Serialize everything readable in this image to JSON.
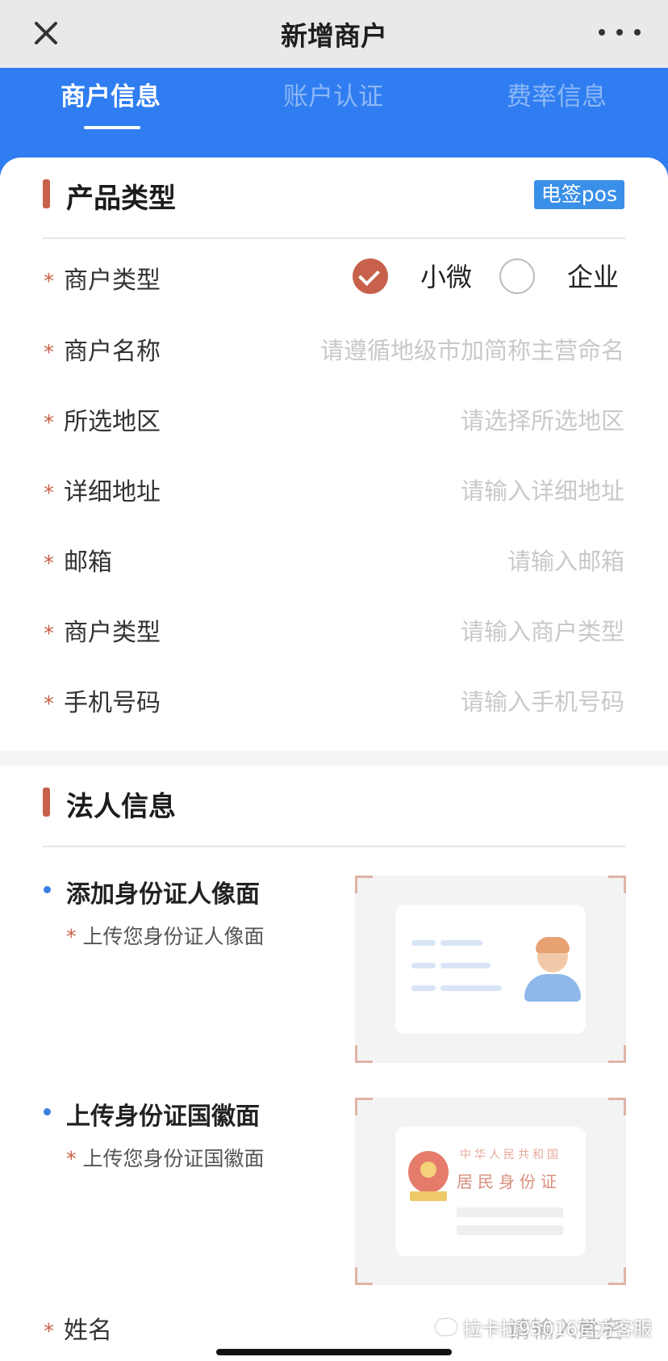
{
  "header": {
    "title": "新增商户"
  },
  "tabs": [
    {
      "label": "商户信息"
    },
    {
      "label": "账户认证"
    },
    {
      "label": "费率信息"
    }
  ],
  "product": {
    "section_title": "产品类型",
    "badge": "电签pos",
    "required_mark": "*",
    "merchant_type": {
      "label": "商户类型",
      "options": [
        {
          "label": "小微",
          "selected": true
        },
        {
          "label": "企业",
          "selected": false
        }
      ]
    },
    "fields": [
      {
        "label": "商户名称",
        "placeholder": "请遵循地级市加简称主营命名"
      },
      {
        "label": "所选地区",
        "placeholder": "请选择所选地区"
      },
      {
        "label": "详细地址",
        "placeholder": "请输入详细地址"
      },
      {
        "label": "邮箱",
        "placeholder": "请输入邮箱"
      },
      {
        "label": "商户类型",
        "placeholder": "请输入商户类型"
      },
      {
        "label": "手机号码",
        "placeholder": "请输入手机号码"
      }
    ]
  },
  "legal": {
    "section_title": "法人信息",
    "front": {
      "title": "添加身份证人像面",
      "sub": "上传您身份证人像面"
    },
    "back": {
      "title": "上传身份证国徽面",
      "sub": "上传您身份证国徽面",
      "card_title_small": "中华人民共和国",
      "card_title_large": "居民身份证"
    },
    "name_field": {
      "label": "姓名",
      "placeholder": "请输入姓名"
    }
  },
  "watermark": "拉卡拉95016官方客服",
  "colors": {
    "primary": "#2f7df0",
    "accent": "#c8614b",
    "badge": "#3a8fe8"
  }
}
